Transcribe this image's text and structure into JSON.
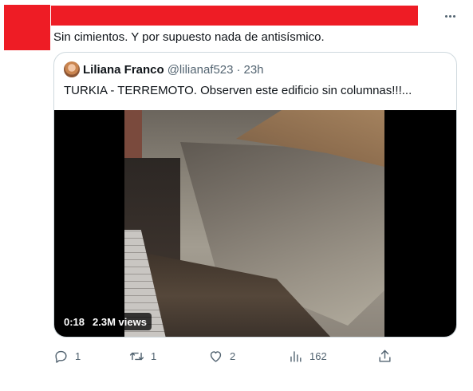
{
  "tweet": {
    "text": "Sin cimientos. Y por supuesto nada de antisísmico."
  },
  "quote": {
    "name": "Liliana Franco",
    "handle": "@lilianaf523",
    "separator": "·",
    "time": "23h",
    "text": "TURKIA  - TERREMOTO. Observen este edificio sin columnas!!!...",
    "video": {
      "duration": "0:18",
      "views": "2.3M views"
    }
  },
  "actions": {
    "replies": "1",
    "retweets": "1",
    "likes": "2",
    "views": "162"
  },
  "colors": {
    "redaction": "#ee1c25",
    "secondary_text": "#536471",
    "border": "#cfd9de"
  },
  "icons": [
    "more-icon",
    "reply-icon",
    "retweet-icon",
    "like-icon",
    "views-icon",
    "share-icon"
  ]
}
